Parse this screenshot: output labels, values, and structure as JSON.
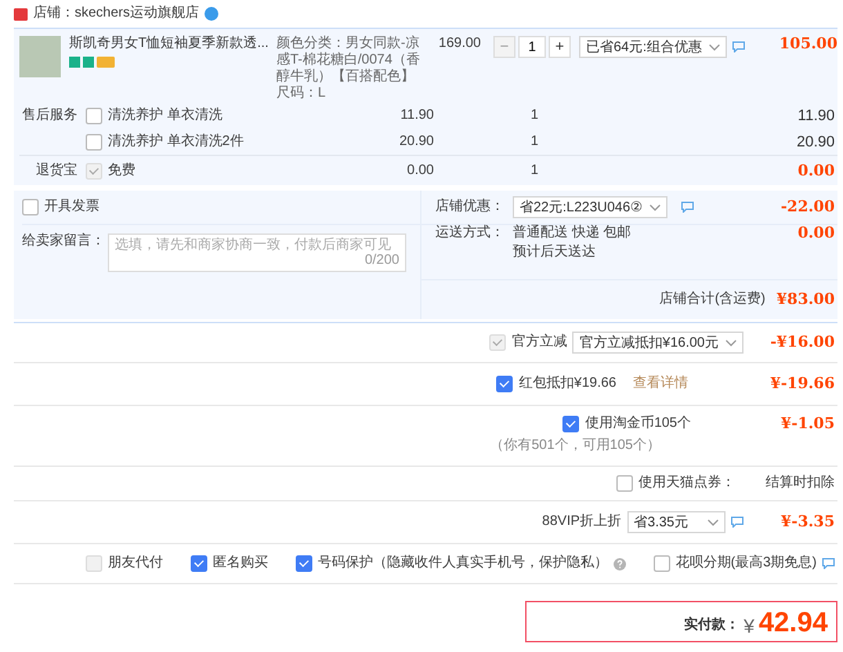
{
  "store": {
    "label": "店铺：skechers运动旗舰店"
  },
  "item": {
    "title": "斯凯奇男女T恤短袖夏季新款透...",
    "sku": [
      "颜色分类：男女同款-凉感T-棉花糖白/0074（香醇牛乳）【百搭配色】",
      "尺码：L"
    ],
    "price": "169.00",
    "minus": "−",
    "quantity": "1",
    "plus": "+",
    "discount": "已省64元:组合优惠",
    "total": "105.00"
  },
  "services": {
    "label": "售后服务",
    "options": [
      {
        "name": "清洗养护 单衣清洗",
        "checked": false,
        "price": "11.90",
        "quantity": "1",
        "total": "11.90"
      },
      {
        "name": "清洗养护 单衣清洗2件",
        "checked": false,
        "price": "20.90",
        "quantity": "1",
        "total": "20.90"
      }
    ]
  },
  "return_insurance": {
    "label": "退货宝",
    "checked": true,
    "disabled": true,
    "name": "免费",
    "price": "0.00",
    "quantity": "1",
    "total": "0.00"
  },
  "invoice": {
    "label": "开具发票",
    "checked": false
  },
  "message": {
    "label": "给卖家留言：",
    "placeholder": "选填，请先和商家协商一致，付款后商家可见",
    "counter": "0/200"
  },
  "store_discount": {
    "label": "店铺优惠：",
    "selection": "省22元:L223U046②",
    "amount": "-22.00"
  },
  "shipping": {
    "label": "运送方式：",
    "method": "普通配送 快递 包邮",
    "estimate": "预计后天送达",
    "amount": "0.00"
  },
  "store_total": {
    "label": "店铺合计(含运费)",
    "amount": "¥83.00"
  },
  "deductions": [
    {
      "kind": "select",
      "label": "官方立减",
      "checked": true,
      "disabled": true,
      "selection": "官方立减抵扣¥16.00元",
      "amount": "-¥16.00"
    },
    {
      "kind": "link",
      "label": "红包抵扣¥19.66",
      "checked": true,
      "disabled": false,
      "link": "查看详情",
      "amount": "¥-19.66"
    },
    {
      "kind": "note",
      "label": "使用淘金币105个",
      "checked": true,
      "disabled": false,
      "note": "（你有501个，可用105个）",
      "amount": "¥-1.05"
    },
    {
      "kind": "value",
      "label": "使用天猫点券：",
      "checked": false,
      "disabled": false,
      "value": "结算时扣除"
    },
    {
      "kind": "vip",
      "label": "88VIP折上折",
      "selection": "省3.35元",
      "amount": "¥-3.35"
    }
  ],
  "options": [
    {
      "kind": "plain",
      "label": "朋友代付",
      "checked": false,
      "disabled": true
    },
    {
      "kind": "plain",
      "label": "匿名购买",
      "checked": true,
      "disabled": false
    },
    {
      "kind": "help",
      "label": "号码保护（隐藏收件人真实手机号，保护隐私）",
      "checked": true,
      "disabled": false
    },
    {
      "kind": "chat",
      "label": "花呗分期(最高3期免息)",
      "checked": false,
      "disabled": false
    }
  ],
  "payment": {
    "label": "实付款：",
    "currency": "¥",
    "amount": "42.94"
  }
}
